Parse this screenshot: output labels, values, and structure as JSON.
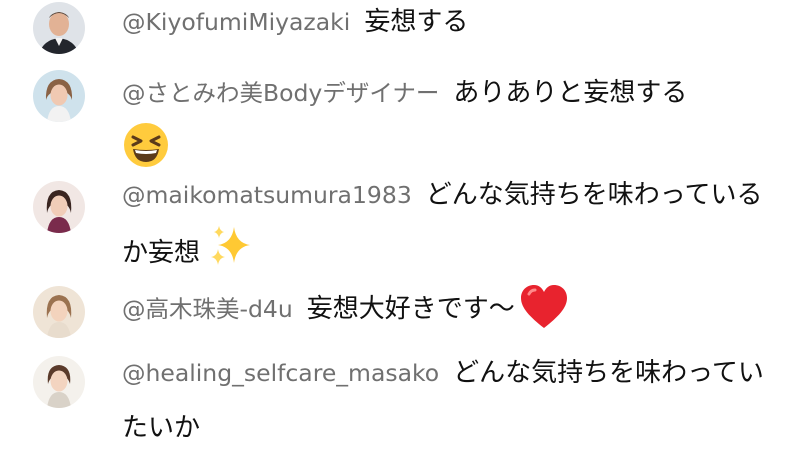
{
  "comments": [
    {
      "username": "@KiyofumiMiyazaki",
      "text": "妄想する"
    },
    {
      "username": "@さとみわ美Bodyデザイナー",
      "text": "ありありと妄想する",
      "emoji": "grinning-squinting-face-icon"
    },
    {
      "username": "@maikomatsumura1983",
      "text": "どんな気持ちを味わっているか妄想",
      "emoji": "sparkles-icon"
    },
    {
      "username": "@高木珠美-d4u",
      "text": "妄想大好きです〜",
      "emoji": "red-heart-icon"
    },
    {
      "username": "@healing_selfcare_masako",
      "text": "どんな気持ちを味わっていたいか"
    }
  ]
}
